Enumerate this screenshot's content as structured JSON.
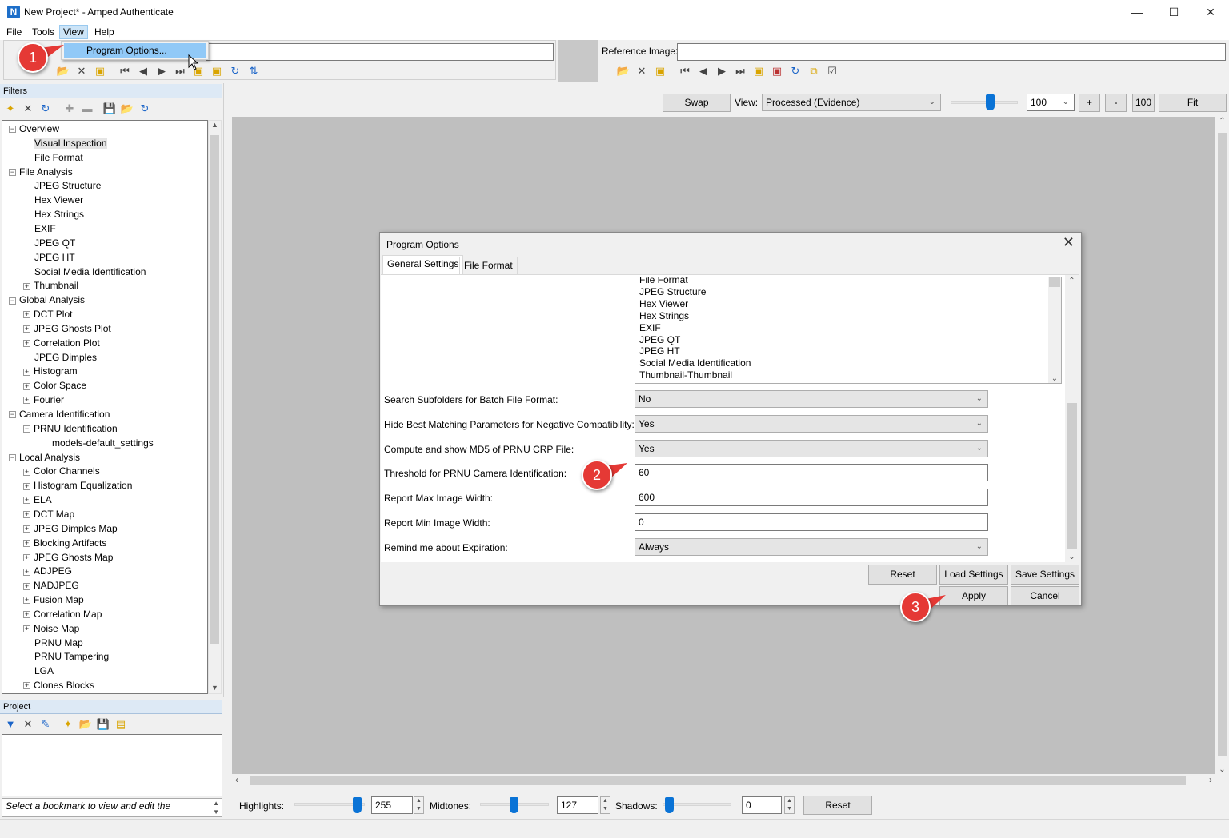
{
  "window": {
    "title": "New Project* - Amped Authenticate",
    "logo": "N",
    "minimize": "—",
    "maximize": "☐",
    "close": "✕"
  },
  "menu": {
    "items": [
      "File",
      "Tools",
      "View",
      "Help"
    ],
    "dropdown_item": "Program Options..."
  },
  "callouts": [
    "1",
    "2",
    "3"
  ],
  "evidence": {
    "value": ""
  },
  "reference": {
    "label": "Reference Image:",
    "value": ""
  },
  "filters": {
    "header": "Filters",
    "tree": [
      {
        "label": "Overview",
        "level": 0,
        "exp": "−"
      },
      {
        "label": "Visual Inspection",
        "level": 1,
        "exp": "",
        "selected": true
      },
      {
        "label": "File Format",
        "level": 1,
        "exp": ""
      },
      {
        "label": "File Analysis",
        "level": 0,
        "exp": "−"
      },
      {
        "label": "JPEG Structure",
        "level": 1,
        "exp": ""
      },
      {
        "label": "Hex Viewer",
        "level": 1,
        "exp": ""
      },
      {
        "label": "Hex Strings",
        "level": 1,
        "exp": ""
      },
      {
        "label": "EXIF",
        "level": 1,
        "exp": ""
      },
      {
        "label": "JPEG QT",
        "level": 1,
        "exp": ""
      },
      {
        "label": "JPEG HT",
        "level": 1,
        "exp": ""
      },
      {
        "label": "Social Media Identification",
        "level": 1,
        "exp": ""
      },
      {
        "label": "Thumbnail",
        "level": 1,
        "exp": "+"
      },
      {
        "label": "Global Analysis",
        "level": 0,
        "exp": "−"
      },
      {
        "label": "DCT Plot",
        "level": 1,
        "exp": "+"
      },
      {
        "label": "JPEG Ghosts Plot",
        "level": 1,
        "exp": "+"
      },
      {
        "label": "Correlation Plot",
        "level": 1,
        "exp": "+"
      },
      {
        "label": "JPEG Dimples",
        "level": 1,
        "exp": ""
      },
      {
        "label": "Histogram",
        "level": 1,
        "exp": "+"
      },
      {
        "label": "Color Space",
        "level": 1,
        "exp": "+"
      },
      {
        "label": "Fourier",
        "level": 1,
        "exp": "+"
      },
      {
        "label": "Camera Identification",
        "level": 0,
        "exp": "−"
      },
      {
        "label": "PRNU Identification",
        "level": 1,
        "exp": "−"
      },
      {
        "label": "models-default_settings",
        "level": 2,
        "exp": ""
      },
      {
        "label": "Local Analysis",
        "level": 0,
        "exp": "−"
      },
      {
        "label": "Color Channels",
        "level": 1,
        "exp": "+"
      },
      {
        "label": "Histogram Equalization",
        "level": 1,
        "exp": "+"
      },
      {
        "label": "ELA",
        "level": 1,
        "exp": "+"
      },
      {
        "label": "DCT Map",
        "level": 1,
        "exp": "+"
      },
      {
        "label": "JPEG Dimples Map",
        "level": 1,
        "exp": "+"
      },
      {
        "label": "Blocking Artifacts",
        "level": 1,
        "exp": "+"
      },
      {
        "label": "JPEG Ghosts Map",
        "level": 1,
        "exp": "+"
      },
      {
        "label": "ADJPEG",
        "level": 1,
        "exp": "+"
      },
      {
        "label": "NADJPEG",
        "level": 1,
        "exp": "+"
      },
      {
        "label": "Fusion Map",
        "level": 1,
        "exp": "+"
      },
      {
        "label": "Correlation Map",
        "level": 1,
        "exp": "+"
      },
      {
        "label": "Noise Map",
        "level": 1,
        "exp": "+"
      },
      {
        "label": "PRNU Map",
        "level": 1,
        "exp": ""
      },
      {
        "label": "PRNU Tampering",
        "level": 1,
        "exp": ""
      },
      {
        "label": "LGA",
        "level": 1,
        "exp": ""
      },
      {
        "label": "Clones Blocks",
        "level": 1,
        "exp": "+"
      }
    ]
  },
  "project": {
    "header": "Project",
    "bookmark_hint": "Select a bookmark to view and edit the"
  },
  "viewer": {
    "swap": "Swap",
    "view_label": "View:",
    "view_value": "Processed (Evidence)",
    "zoom_value": "100",
    "plus": "+",
    "minus": "-",
    "hundred": "100",
    "fit": "Fit"
  },
  "dialog": {
    "title": "Program Options",
    "close": "✕",
    "tabs": [
      "General Settings",
      "File Format"
    ],
    "list_items": [
      "File Format",
      "JPEG Structure",
      "Hex Viewer",
      "Hex Strings",
      "EXIF",
      "JPEG QT",
      "JPEG HT",
      "Social Media Identification",
      "Thumbnail-Thumbnail"
    ],
    "settings": [
      {
        "label": "Search Subfolders for Batch File Format:",
        "value": "No",
        "kind": "select"
      },
      {
        "label": "Hide Best Matching Parameters for Negative Compatibility:",
        "value": "Yes",
        "kind": "select"
      },
      {
        "label": "Compute and show MD5 of PRNU CRP File:",
        "value": "Yes",
        "kind": "select"
      },
      {
        "label": "Threshold for PRNU Camera Identification:",
        "value": "60",
        "kind": "input"
      },
      {
        "label": "Report Max Image Width:",
        "value": "600",
        "kind": "input"
      },
      {
        "label": "Report Min Image Width:",
        "value": "0",
        "kind": "input"
      },
      {
        "label": "Remind me about Expiration:",
        "value": "Always",
        "kind": "select"
      }
    ],
    "buttons": {
      "reset": "Reset",
      "load": "Load Settings",
      "save": "Save Settings",
      "apply": "Apply",
      "cancel": "Cancel"
    }
  },
  "levels": {
    "highlights_label": "Highlights:",
    "highlights_value": "255",
    "midtones_label": "Midtones:",
    "midtones_value": "127",
    "shadows_label": "Shadows:",
    "shadows_value": "0",
    "reset": "Reset"
  }
}
